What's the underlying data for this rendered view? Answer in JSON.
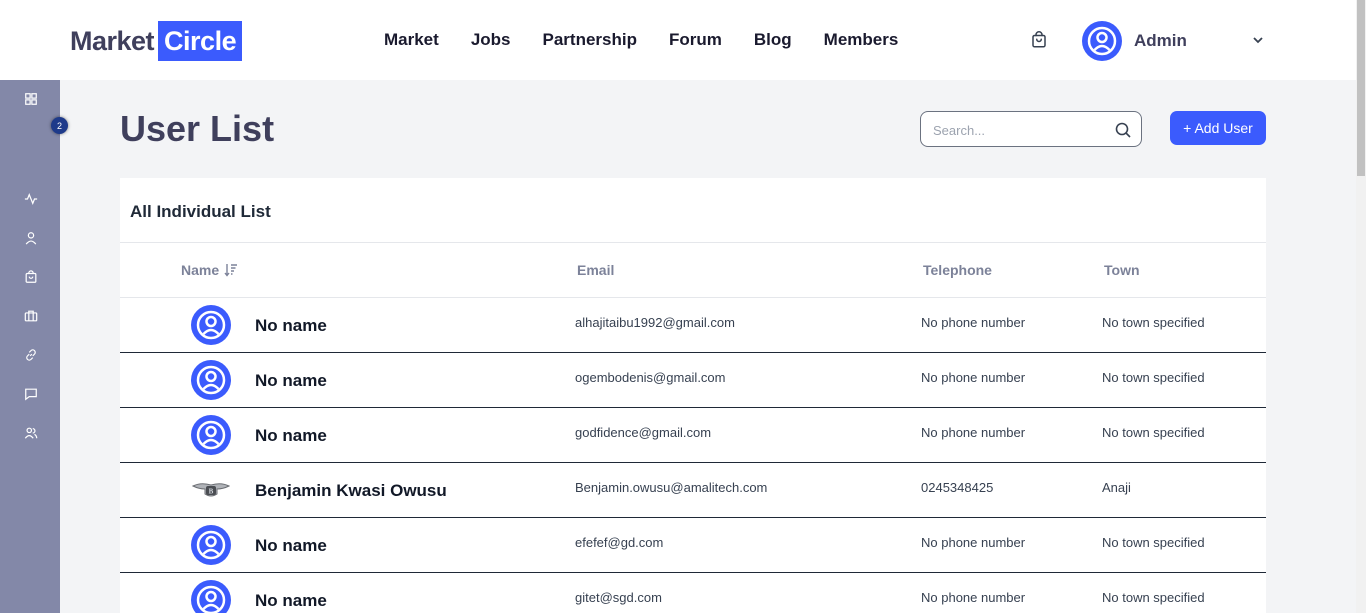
{
  "header": {
    "logo_part1": "Market",
    "logo_part2": "Circle",
    "nav": [
      "Market",
      "Jobs",
      "Partnership",
      "Forum",
      "Blog",
      "Members"
    ],
    "cart_icon": "shopping-bag-icon",
    "admin_name": "Admin",
    "accent_color": "#3b5bfd"
  },
  "sidebar": {
    "badge": "2",
    "icons": [
      "dashboard-icon",
      "activity-icon",
      "user-icon",
      "shopping-bag-icon",
      "briefcase-icon",
      "link-icon",
      "message-icon",
      "users-icon"
    ]
  },
  "main": {
    "title": "User List",
    "search_placeholder": "Search...",
    "add_button": "+ Add User",
    "card_title": "All Individual List",
    "columns": {
      "name": "Name",
      "email": "Email",
      "telephone": "Telephone",
      "town": "Town"
    },
    "rows": [
      {
        "name": "No name",
        "email": "alhajitaibu1992@gmail.com",
        "telephone": "No phone number",
        "town": "No town specified",
        "avatar": "default"
      },
      {
        "name": "No name",
        "email": "ogembodenis@gmail.com",
        "telephone": "No phone number",
        "town": "No town specified",
        "avatar": "default"
      },
      {
        "name": "No name",
        "email": "godfidence@gmail.com",
        "telephone": "No phone number",
        "town": "No town specified",
        "avatar": "default"
      },
      {
        "name": "Benjamin Kwasi Owusu",
        "email": "Benjamin.owusu@amalitech.com",
        "telephone": "0245348425",
        "town": "Anaji",
        "avatar": "photo"
      },
      {
        "name": "No name",
        "email": "efefef@gd.com",
        "telephone": "No phone number",
        "town": "No town specified",
        "avatar": "default"
      },
      {
        "name": "No name",
        "email": "gitet@sgd.com",
        "telephone": "No phone number",
        "town": "No town specified",
        "avatar": "default"
      }
    ]
  }
}
